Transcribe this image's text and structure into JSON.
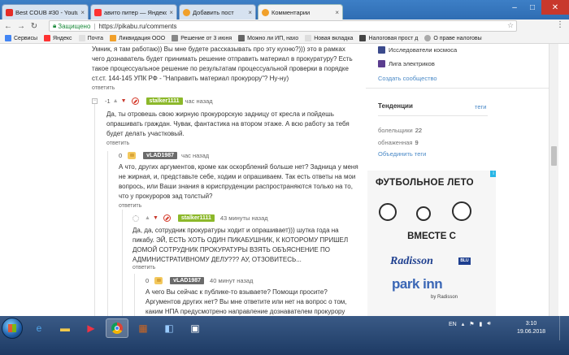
{
  "tabs": [
    {
      "title": "Best COUB #30 - Youtub",
      "icon_color": "#e52d27",
      "icon": "youtube-icon"
    },
    {
      "title": "авито питер — Яндекс",
      "icon_color": "#f33",
      "icon": "yandex-icon"
    },
    {
      "title": "Добавить пост",
      "icon_color": "#f1a02a",
      "icon": "pikabu-icon"
    },
    {
      "title": "Комментарии",
      "icon_color": "#f1a02a",
      "icon": "pikabu-icon"
    }
  ],
  "toolbar": {
    "secure_label": "Защищено",
    "separator": "|",
    "url": "https://pikabu.ru/comments"
  },
  "bookmarks": [
    {
      "label": "Сервисы",
      "color": "#4285f4"
    },
    {
      "label": "Яндекс",
      "color": "#f33"
    },
    {
      "label": "Почта",
      "color": "#e0e0e0"
    },
    {
      "label": "Ликвидация ООО",
      "color": "#f1a02a"
    },
    {
      "label": "Решение от 3 июня",
      "color": "#888"
    },
    {
      "label": "Можно ли ИП, нахо",
      "color": "#666"
    },
    {
      "label": "Новая вкладка",
      "color": "#ddd"
    },
    {
      "label": "Налоговая прост д",
      "color": "#444"
    },
    {
      "label": "О праве налоговы",
      "color": "#aaa"
    }
  ],
  "comments": {
    "c0_lines": [
      "Умник, я там работаю)) Вы мне будете рассказывать про эту кухню?))) это в рамках",
      "чего дознаватель будет принимать решение отправить материал в прокуратуру? Есть",
      "такое процессуальное решение по результатам процессуальной проверки в порядке",
      "ст.ст. 144-145 УПК РФ - \"Направить материал прокурору\"? Ну-ну)"
    ],
    "reply_label": "ответить",
    "c1": {
      "score": "-1",
      "user": "stalker1111",
      "time": "час назад",
      "lines": [
        "Да, ты отровешь свою жирную прокурорскую задницу от кресла и пойдешь",
        "опрашивать граждан. Чувак, фантастика на втором этаже. А всю работу за тебя",
        "будет делать участковый."
      ]
    },
    "c2": {
      "score": "0",
      "user": "vLAD1987",
      "time": "час назад",
      "lines": [
        "А что, других аргументов, кроме как оскорблений больше нет? Задница у меня",
        "не жирная, и, представьте себе, ходим и опрашиваем. Так есть ответы на мои",
        "вопрось, или Ваши знания в юриспруденции распространяются только на то,",
        "что у прокуроров зад толстый?"
      ]
    },
    "c3": {
      "user": "stalker1111",
      "time": "43 минуты назад",
      "lines": [
        "Да, да, сотрудник прокуратуры ходит и опрашивает))) шутка года на",
        "пикабу. ЭЙ, ЕСТЬ ХОТЬ ОДИН ПИКАБУШНИК, К КОТОРОМУ ПРИШЕЛ",
        "ДОМОЙ СОТРУДНИК ПРОКУРАТУРЫ ВЗЯТЬ ОБЪЯСНЕНИЕ ПО",
        "АДМИНИСТРАТИВНОМУ ДЕЛУ??? АУ, ОТЗОВИТЕСЬ..."
      ]
    },
    "c4": {
      "score": "0",
      "user": "vLAD1987",
      "time": "40 минут назад",
      "lines": [
        "А чего Вы сейчас к публике-то взываете? Помощи просите?",
        "Аргументов других нет? Вы мне ответите или нет на вопрос о том,",
        "каким НПА предусмотрено направление дознавателем прокурору"
      ]
    }
  },
  "sidebar": {
    "communities": [
      {
        "label": "Исследователи космоса",
        "color": "#3b4a8c"
      },
      {
        "label": "Лига электриков",
        "color": "#5b3d8f"
      }
    ],
    "create_community": "Создать сообщество",
    "trends_title": "Тенденции",
    "tags_link": "теги",
    "tags": [
      {
        "name": "болельщики",
        "count": "22"
      },
      {
        "name": "обнаженная",
        "count": "9"
      }
    ],
    "merge_tags": "Объединить теги"
  },
  "ad": {
    "title": "ФУТБОЛЬНОЕ ЛЕТО",
    "subtitle": "ВМЕСТЕ С",
    "brand1": "Radisson",
    "brand1_badge": "BLU",
    "brand2": "park inn",
    "brand2_by": "by Radisson",
    "badge": "i"
  },
  "taskbar": {
    "lang": "EN",
    "time": "3:10",
    "date": "19.06.2018"
  },
  "colors": {
    "accent_green": "#8cb82a",
    "accent_blue": "#4b8ac7",
    "downvote": "#c8382c"
  }
}
